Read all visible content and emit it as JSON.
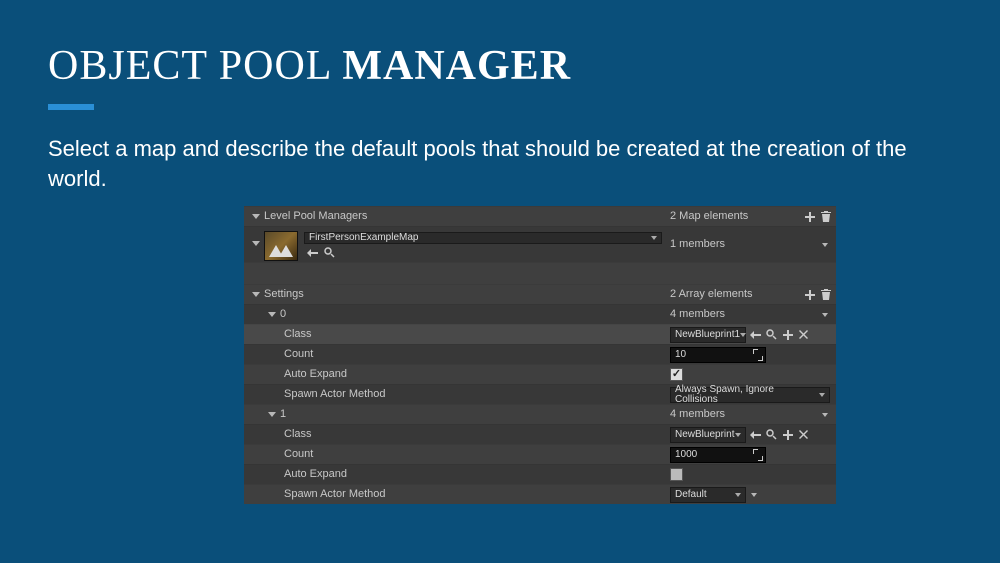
{
  "title_thin": "OBJECT POOL ",
  "title_bold": "MANAGER",
  "subtitle": "Select a map and describe the default pools that should be created at the creation of the world.",
  "panel": {
    "header_label": "Level Pool Managers",
    "header_summary": "2 Map elements",
    "map_name": "FirstPersonExampleMap",
    "map_summary": "1 members",
    "settings_label": "Settings",
    "settings_summary": "2 Array elements",
    "entries": [
      {
        "idx": "0",
        "summary": "4 members",
        "class_label": "Class",
        "class_value": "NewBlueprint1",
        "count_label": "Count",
        "count_value": "10",
        "auto_label": "Auto Expand",
        "auto_checked": true,
        "spawn_label": "Spawn Actor Method",
        "spawn_value": "Always Spawn, Ignore Collisions"
      },
      {
        "idx": "1",
        "summary": "4 members",
        "class_label": "Class",
        "class_value": "NewBlueprint",
        "count_label": "Count",
        "count_value": "1000",
        "auto_label": "Auto Expand",
        "auto_checked": false,
        "spawn_label": "Spawn Actor Method",
        "spawn_value": "Default"
      }
    ]
  }
}
